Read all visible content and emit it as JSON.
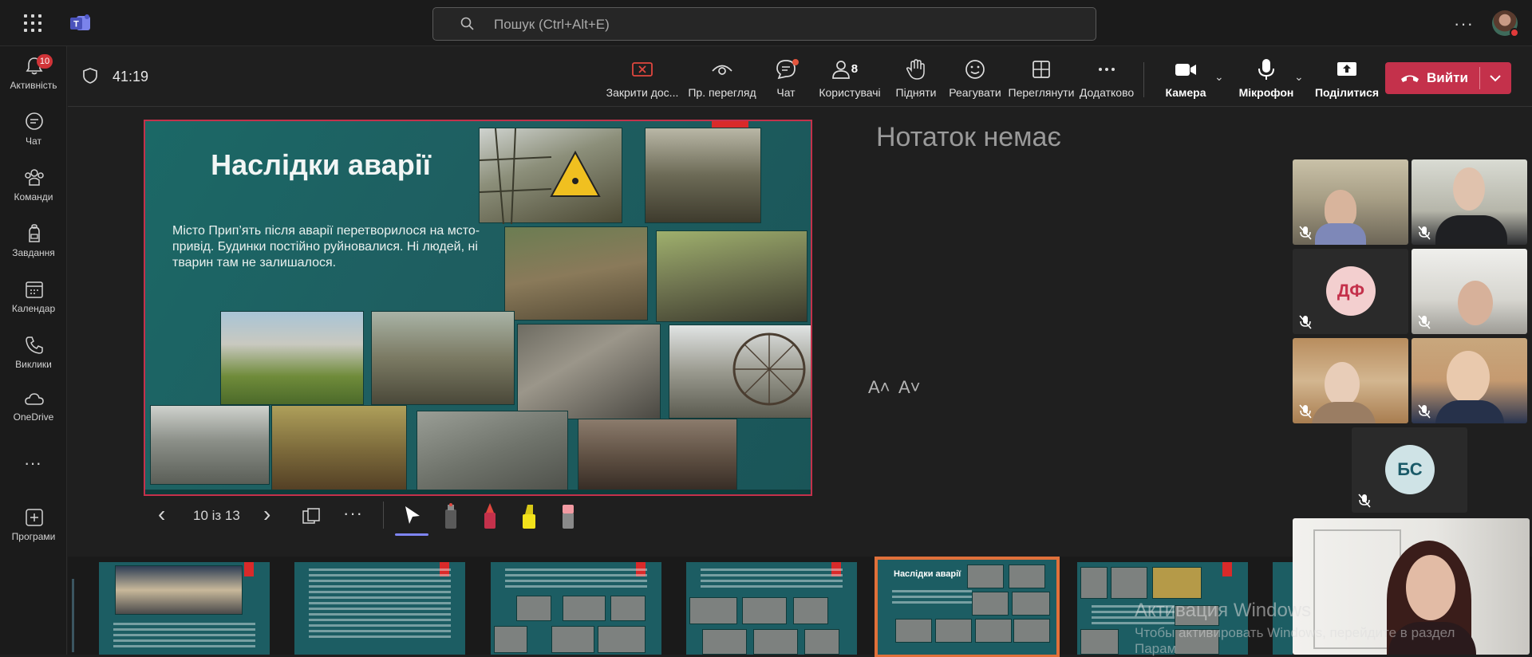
{
  "search": {
    "placeholder": "Пошук (Ctrl+Alt+E)"
  },
  "rail": {
    "items": [
      {
        "label": "Активність",
        "icon": "bell-icon",
        "badge": "10"
      },
      {
        "label": "Чат",
        "icon": "chat-icon"
      },
      {
        "label": "Команди",
        "icon": "teams-icon"
      },
      {
        "label": "Завдання",
        "icon": "backpack-icon"
      },
      {
        "label": "Календар",
        "icon": "calendar-icon"
      },
      {
        "label": "Виклики",
        "icon": "phone-icon"
      },
      {
        "label": "OneDrive",
        "icon": "cloud-icon"
      },
      {
        "label": "Програми",
        "icon": "add-app-icon"
      }
    ]
  },
  "meeting": {
    "timer": "41:19",
    "toolbar": {
      "stop_share": "Закрити дос...",
      "preview": "Пр. перегляд",
      "chat": "Чат",
      "people": "Користувачі",
      "people_count": "8",
      "raise": "Підняти",
      "react": "Реагувати",
      "view": "Переглянути",
      "more": "Додатково",
      "camera": "Камера",
      "mic": "Мікрофон",
      "share": "Поділитися",
      "leave": "Вийти"
    }
  },
  "slide": {
    "title": "Наслідки аварії",
    "body": "Місто Прип’ять після аварії  перетворилося на мсто-привід. Будинки постійно руйновалися. Ні людей, ні тварин там не залишалося."
  },
  "slidenav": {
    "page": "10 із 13"
  },
  "notes": {
    "empty": "Нотаток немає",
    "font_up": "A˄",
    "font_down": "A˅"
  },
  "participants": [
    {
      "type": "video",
      "muted": true
    },
    {
      "type": "video",
      "muted": true
    },
    {
      "type": "avatar",
      "initials": "ДФ",
      "muted": true,
      "color": "#f3cfcf",
      "text_color": "#c4314b"
    },
    {
      "type": "video",
      "muted": true
    },
    {
      "type": "video",
      "muted": true
    },
    {
      "type": "video",
      "muted": true
    },
    {
      "type": "avatar",
      "initials": "БС",
      "muted": true,
      "color": "#cfe3e6",
      "text_color": "#1a5a68"
    },
    {
      "type": "presenter-video"
    }
  ],
  "thumbnails": [
    {
      "index": 6
    },
    {
      "index": 7
    },
    {
      "index": 8
    },
    {
      "index": 9
    },
    {
      "index": 10,
      "title": "Наслідки аварії",
      "active": true
    },
    {
      "index": 11
    }
  ],
  "windows_watermark": {
    "line1": "Активация Windows",
    "line2": "Чтобы активировать Windows, перейдите в раздел",
    "line3": "Парам"
  }
}
